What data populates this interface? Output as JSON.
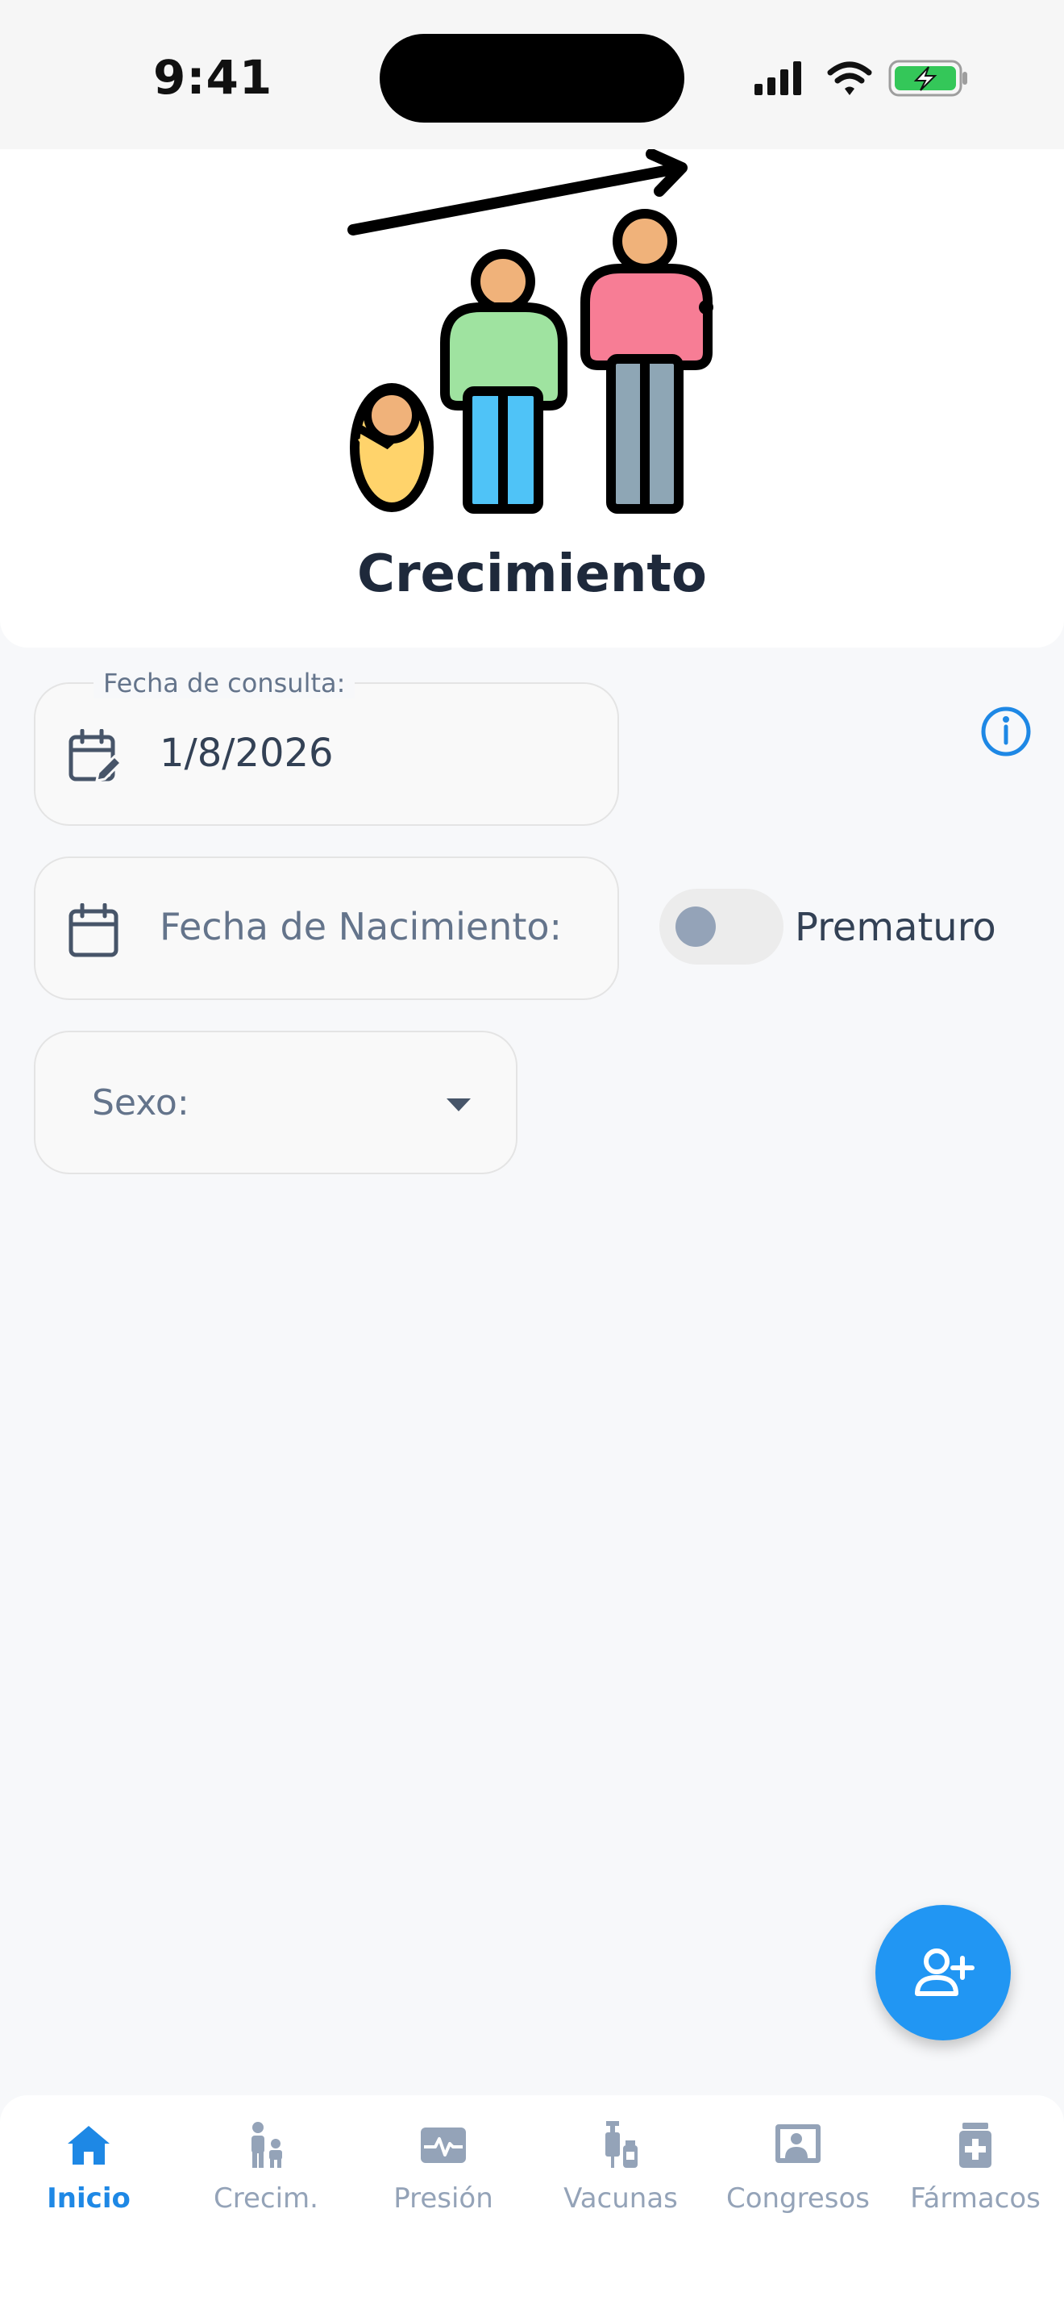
{
  "status_bar": {
    "time": "9:41",
    "icons": [
      "signal-icon",
      "wifi-icon",
      "battery-charging-icon"
    ]
  },
  "header": {
    "title": "Crecimiento",
    "info_icon": "info-icon",
    "hero_image": "growth-family-illustration"
  },
  "form": {
    "consulta": {
      "label": "Fecha de consulta:",
      "value": "1/8/2026",
      "icon": "calendar-edit-icon"
    },
    "nacimiento": {
      "placeholder": "Fecha de Nacimiento:",
      "icon": "calendar-icon"
    },
    "prematuro": {
      "label": "Prematuro",
      "checked": false
    },
    "sexo": {
      "label": "Sexo:",
      "icon": "dropdown-arrow-icon"
    }
  },
  "fab": {
    "icon": "add-person-icon"
  },
  "nav": {
    "items": [
      {
        "label": "Inicio",
        "icon": "home-icon",
        "active": true
      },
      {
        "label": "Crecim.",
        "icon": "child-growth-icon",
        "active": false
      },
      {
        "label": "Presión",
        "icon": "heart-monitor-icon",
        "active": false
      },
      {
        "label": "Vacunas",
        "icon": "vaccine-icon",
        "active": false
      },
      {
        "label": "Congresos",
        "icon": "presentation-icon",
        "active": false
      },
      {
        "label": "Fármacos",
        "icon": "medicine-icon",
        "active": false
      }
    ]
  },
  "colors": {
    "accent": "#1e88e5",
    "fab": "#2196f3",
    "inactive": "#94a3b8",
    "background": "#f7f8fa"
  }
}
